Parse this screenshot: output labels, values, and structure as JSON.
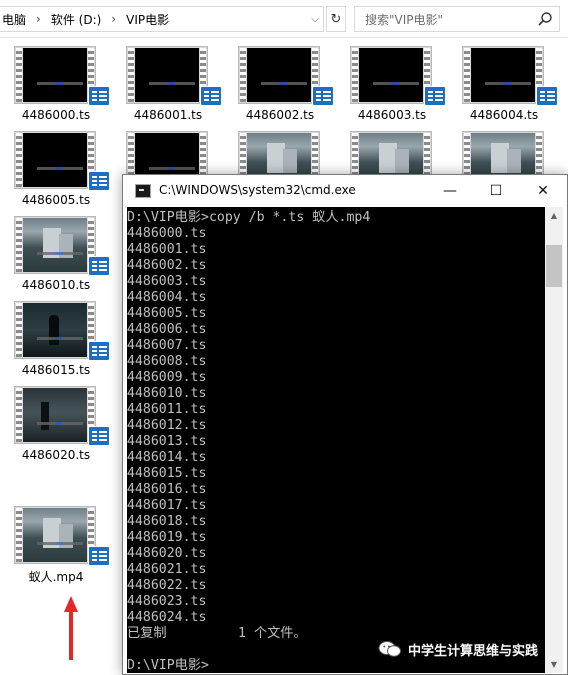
{
  "explorer": {
    "breadcrumbs": [
      "电脑",
      "软件 (D:)",
      "VIP电影"
    ],
    "search_placeholder": "搜索\"VIP电影\"",
    "files": [
      {
        "name": "4486000.ts",
        "frame": "black"
      },
      {
        "name": "4486001.ts",
        "frame": "black"
      },
      {
        "name": "4486002.ts",
        "frame": "black"
      },
      {
        "name": "4486003.ts",
        "frame": "black"
      },
      {
        "name": "4486004.ts",
        "frame": "black"
      },
      {
        "name": "4486005.ts",
        "frame": "black"
      },
      {
        "name": "",
        "frame": "black"
      },
      {
        "name": "",
        "frame": "city"
      },
      {
        "name": "",
        "frame": "city"
      },
      {
        "name": "",
        "frame": "city"
      },
      {
        "name": "4486010.ts",
        "frame": "city"
      },
      {
        "name": "4486015.ts",
        "frame": "dark"
      },
      {
        "name": "4486020.ts",
        "frame": "hall"
      },
      {
        "name": "蚁人.mp4",
        "frame": "city"
      }
    ]
  },
  "cmd": {
    "title": "C:\\WINDOWS\\system32\\cmd.exe",
    "lines": [
      "D:\\VIP电影>copy /b *.ts 蚁人.mp4",
      "4486000.ts",
      "4486001.ts",
      "4486002.ts",
      "4486003.ts",
      "4486004.ts",
      "4486005.ts",
      "4486006.ts",
      "4486007.ts",
      "4486008.ts",
      "4486009.ts",
      "4486010.ts",
      "4486011.ts",
      "4486012.ts",
      "4486013.ts",
      "4486014.ts",
      "4486015.ts",
      "4486016.ts",
      "4486017.ts",
      "4486018.ts",
      "4486019.ts",
      "4486020.ts",
      "4486021.ts",
      "4486022.ts",
      "4486023.ts",
      "4486024.ts",
      "已复制         1 个文件。",
      "",
      "D:\\VIP电影>"
    ],
    "minimize_glyph": "—",
    "maximize_glyph": "☐",
    "close_glyph": "✕"
  },
  "watermark": {
    "text": "中学生计算思维与实践"
  },
  "colors": {
    "arrow": "#e8262a",
    "badge": "#1e6fc4",
    "console_bg": "#000000",
    "console_text": "#c0c0c0"
  }
}
